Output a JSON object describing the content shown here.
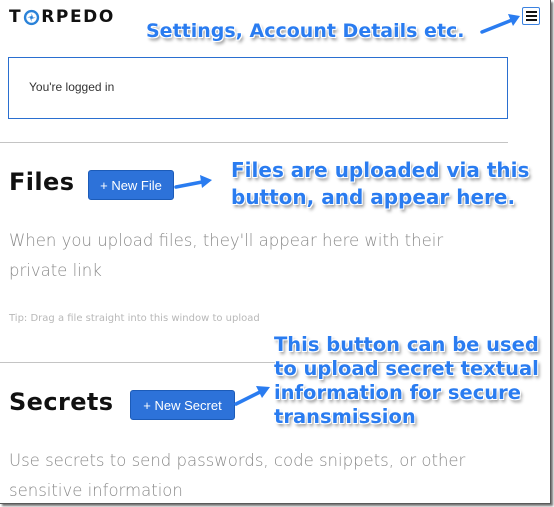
{
  "header": {
    "logo_text_pre": "T",
    "logo_text_post": "RPEDO",
    "logo_icon": "torpedo-logo-icon",
    "menu_icon": "hamburger-menu-icon"
  },
  "status": {
    "logged_in_text": "You're logged in"
  },
  "files": {
    "title": "Files",
    "new_button_label": "+ New File",
    "empty_text": "When you upload files, they'll appear here with their private link",
    "tip": "Tip: Drag a file straight into this window to upload"
  },
  "secrets": {
    "title": "Secrets",
    "new_button_label": "+ New Secret",
    "empty_text": "Use secrets to send passwords, code snippets, or other sensitive information"
  },
  "annotations": {
    "menu": "Settings, Account Details etc.",
    "files": "Files are uploaded via this button, and appear here.",
    "secrets": "This button can be used to upload secret textual information for secure transmission"
  },
  "colors": {
    "accent": "#2d72d9",
    "annotation": "#2a7cf0",
    "logo_icon": "#2a82d8"
  }
}
